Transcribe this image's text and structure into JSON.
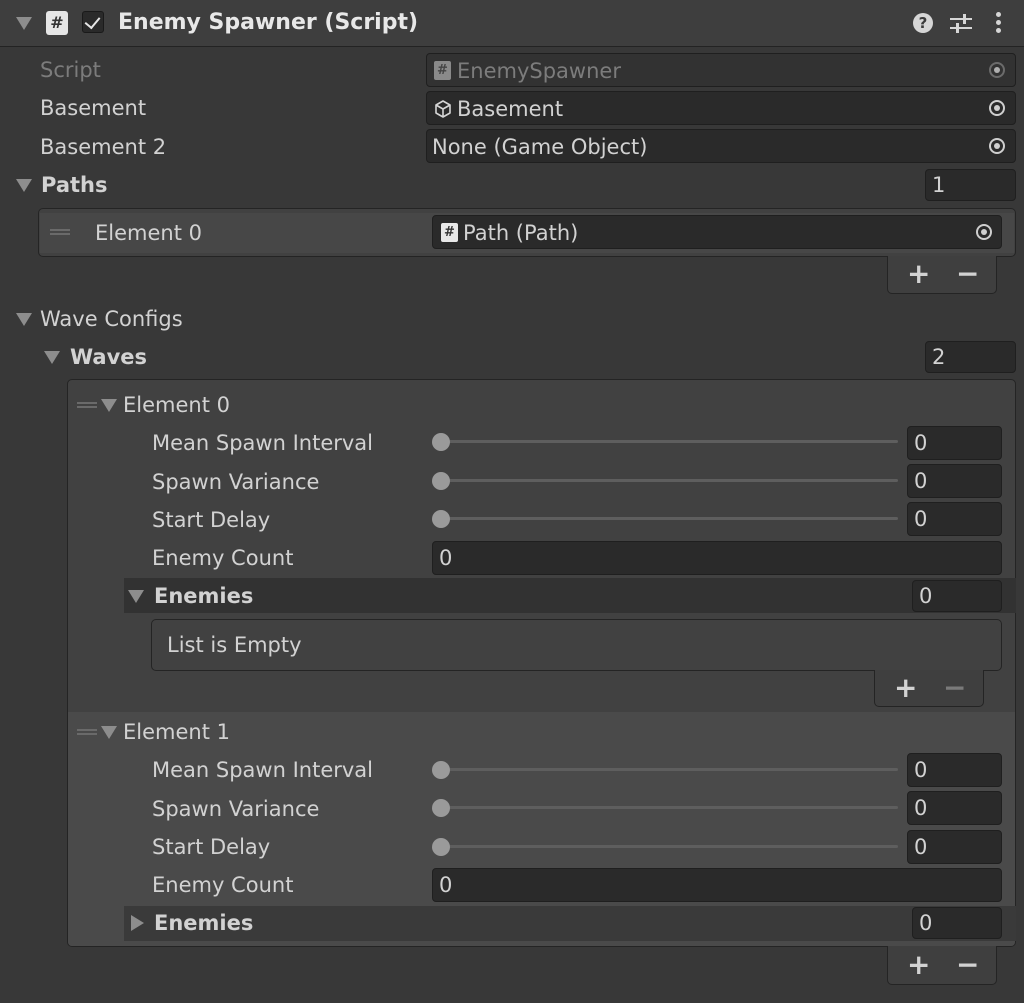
{
  "component": {
    "title": "Enemy Spawner (Script)",
    "enabled": true,
    "icons": [
      "help-icon",
      "presets-icon",
      "more-options-icon"
    ]
  },
  "script_field": {
    "label": "Script",
    "value": "EnemySpawner"
  },
  "basement_field": {
    "label": "Basement",
    "value": "Basement"
  },
  "basement2_field": {
    "label": "Basement 2",
    "value": "None (Game Object)"
  },
  "paths": {
    "label": "Paths",
    "size": "1",
    "elements": [
      {
        "label": "Element 0",
        "value": "Path (Path)"
      }
    ]
  },
  "wave_configs": {
    "label": "Wave Configs",
    "waves": {
      "label": "Waves",
      "size": "2",
      "elements": [
        {
          "label": "Element 0",
          "mean_spawn_interval": {
            "label": "Mean Spawn Interval",
            "value": "0"
          },
          "spawn_variance": {
            "label": "Spawn Variance",
            "value": "0"
          },
          "start_delay": {
            "label": "Start Delay",
            "value": "0"
          },
          "enemy_count": {
            "label": "Enemy Count",
            "value": "0"
          },
          "enemies": {
            "label": "Enemies",
            "size": "0",
            "empty_text": "List is Empty"
          }
        },
        {
          "label": "Element 1",
          "mean_spawn_interval": {
            "label": "Mean Spawn Interval",
            "value": "0"
          },
          "spawn_variance": {
            "label": "Spawn Variance",
            "value": "0"
          },
          "start_delay": {
            "label": "Start Delay",
            "value": "0"
          },
          "enemy_count": {
            "label": "Enemy Count",
            "value": "0"
          },
          "enemies": {
            "label": "Enemies",
            "size": "0"
          }
        }
      ]
    }
  },
  "list_buttons": {
    "add": "+",
    "remove": "−"
  }
}
